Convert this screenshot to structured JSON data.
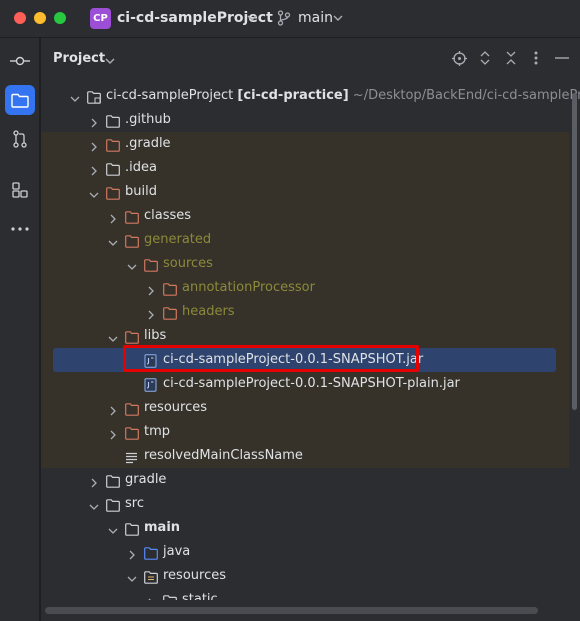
{
  "window": {
    "project_badge": "CP",
    "project_name": "ci-cd-sampleProject",
    "branch_name": "main"
  },
  "project_panel": {
    "title": "Project",
    "tree": [
      {
        "label": "ci-cd-sampleProject",
        "module": "[ci-cd-practice]",
        "path": "~/Desktop/BackEnd/ci-cd-sampleProje",
        "depth": 0,
        "expanded": true,
        "icon": "module-folder-icon",
        "tint": false
      },
      {
        "label": ".github",
        "depth": 1,
        "expanded": false,
        "icon": "folder-icon",
        "tint": false
      },
      {
        "label": ".gradle",
        "depth": 1,
        "expanded": false,
        "icon": "excluded-folder-icon",
        "tint": true
      },
      {
        "label": ".idea",
        "depth": 1,
        "expanded": false,
        "icon": "folder-icon",
        "tint": true
      },
      {
        "label": "build",
        "depth": 1,
        "expanded": true,
        "icon": "excluded-folder-icon",
        "tint": true
      },
      {
        "label": "classes",
        "depth": 2,
        "expanded": false,
        "icon": "excluded-folder-icon",
        "tint": true
      },
      {
        "label": "generated",
        "depth": 2,
        "expanded": true,
        "icon": "excluded-folder-icon",
        "tint": true,
        "style": "olive"
      },
      {
        "label": "sources",
        "depth": 3,
        "expanded": true,
        "icon": "excluded-folder-icon",
        "tint": true,
        "style": "olive"
      },
      {
        "label": "annotationProcessor",
        "depth": 4,
        "expanded": false,
        "icon": "excluded-folder-icon",
        "tint": true,
        "style": "olive"
      },
      {
        "label": "headers",
        "depth": 4,
        "expanded": false,
        "icon": "excluded-folder-icon",
        "tint": true,
        "style": "olive"
      },
      {
        "label": "libs",
        "depth": 2,
        "expanded": true,
        "icon": "excluded-folder-icon",
        "tint": true
      },
      {
        "label": "ci-cd-sampleProject-0.0.1-SNAPSHOT.jar",
        "depth": 3,
        "leaf": true,
        "icon": "jar-file-icon",
        "selected": true,
        "tint": true
      },
      {
        "label": "ci-cd-sampleProject-0.0.1-SNAPSHOT-plain.jar",
        "depth": 3,
        "leaf": true,
        "icon": "jar-file-icon",
        "tint": true
      },
      {
        "label": "resources",
        "depth": 2,
        "expanded": false,
        "icon": "excluded-folder-icon",
        "tint": true
      },
      {
        "label": "tmp",
        "depth": 2,
        "expanded": false,
        "icon": "excluded-folder-icon",
        "tint": true
      },
      {
        "label": "resolvedMainClassName",
        "depth": 2,
        "leaf": true,
        "icon": "text-file-icon",
        "tint": true
      },
      {
        "label": "gradle",
        "depth": 1,
        "expanded": false,
        "icon": "folder-icon",
        "tint": false
      },
      {
        "label": "src",
        "depth": 1,
        "expanded": true,
        "icon": "folder-icon",
        "tint": false
      },
      {
        "label": "main",
        "depth": 2,
        "expanded": true,
        "icon": "folder-icon",
        "tint": false,
        "style": "bold"
      },
      {
        "label": "java",
        "depth": 3,
        "expanded": false,
        "icon": "source-folder-icon",
        "tint": false
      },
      {
        "label": "resources",
        "depth": 3,
        "expanded": true,
        "icon": "resources-folder-icon",
        "tint": false
      },
      {
        "label": "static",
        "depth": 4,
        "expanded": false,
        "icon": "folder-icon",
        "tint": false
      }
    ]
  },
  "colors": {
    "accent": "#3574f0",
    "selection": "#2e436e",
    "excluded_folder": "#d0785f",
    "excluded_tint": "#36322a",
    "highlight_box": "#e60000"
  }
}
